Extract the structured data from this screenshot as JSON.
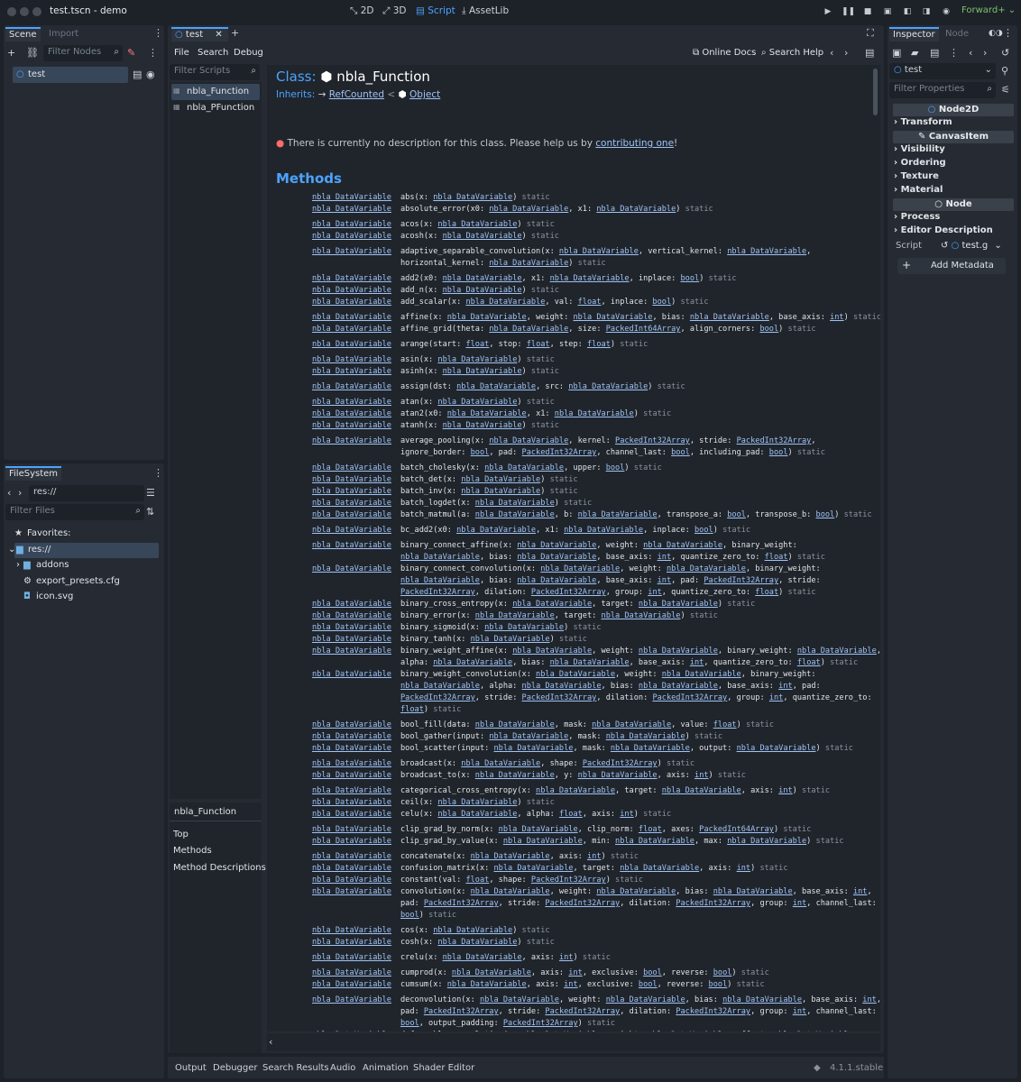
{
  "window": {
    "title": "test.tscn - demo",
    "renderer": "Forward+",
    "version": "4.1.1.stable"
  },
  "modes": [
    "2D",
    "3D",
    "Script",
    "AssetLib"
  ],
  "icons": {
    "mode_2d": "2d-viewport-icon",
    "mode_3d": "3d-viewport-icon",
    "mode_script": "script-icon",
    "mode_assetlib": "assetlib-icon",
    "play": "play-icon",
    "pause": "pause-icon",
    "stop": "stop-icon",
    "add": "plus-icon",
    "link": "link-icon",
    "search": "search-icon",
    "circle": "node-circle-icon",
    "eye": "eye-icon",
    "script": "script-icon",
    "folder": "folder-icon",
    "gear": "gear-icon",
    "image": "image-icon",
    "star": "star-icon",
    "filter": "filter-icon",
    "back": "back-icon",
    "doc": "doc-icon",
    "online": "external-link-icon"
  },
  "scene_dock": {
    "tabs": [
      "Scene",
      "Import"
    ],
    "filter_placeholder": "Filter Nodes",
    "root_node": "test"
  },
  "filesystem": {
    "title": "FileSystem",
    "path": "res://",
    "filter_placeholder": "Filter Files",
    "favorites_label": "Favorites:",
    "tree": [
      "res://",
      "addons",
      "export_presets.cfg",
      "icon.svg"
    ]
  },
  "script_editor": {
    "tab": "test",
    "menu": [
      "File",
      "Search",
      "Debug"
    ],
    "online_docs": "Online Docs",
    "search_help": "Search Help",
    "filter_scripts_placeholder": "Filter Scripts",
    "scripts": [
      "nbla_Function",
      "nbla_PFunction"
    ],
    "outline_title": "nbla_Function",
    "outline": [
      "Top",
      "Methods",
      "Method Descriptions"
    ]
  },
  "doc": {
    "class_label": "Class:",
    "class_name": "nbla_Function",
    "inherits_label": "Inherits:",
    "inherits": [
      "RefCounted",
      "Object"
    ],
    "no_desc": "There is currently no description for this class. Please help us by ",
    "contrib": "contributing one",
    "methods_title": "Methods",
    "ret_type": "nbla_DataVariable"
  },
  "methods": [
    [
      0,
      "abs(x: ~nbla_DataVariable~) static"
    ],
    [
      13,
      "absolute_error(x0: ~nbla_DataVariable~, x1: ~nbla_DataVariable~) static"
    ],
    [
      30,
      "acos(x: ~nbla_DataVariable~) static"
    ],
    [
      43,
      "acosh(x: ~nbla_DataVariable~) static"
    ],
    [
      60,
      "adaptive_separable_convolution(x: ~nbla_DataVariable~, vertical_kernel: ~nbla_DataVariable~,"
    ],
    [
      73,
      "~horizontal_kernel: ~nbla_DataVariable~) static"
    ],
    [
      90,
      "add2(x0: ~nbla_DataVariable~, x1: ~nbla_DataVariable~, inplace: ~bool~) static"
    ],
    [
      103,
      "add_n(x: ~nbla_DataVariable~) static"
    ],
    [
      116,
      "add_scalar(x: ~nbla_DataVariable~, val: ~float~, inplace: ~bool~) static"
    ],
    [
      133,
      "affine(x: ~nbla_DataVariable~, weight: ~nbla_DataVariable~, bias: ~nbla_DataVariable~, base_axis: ~int~) static"
    ],
    [
      146,
      "affine_grid(theta: ~nbla_DataVariable~, size: ~PackedInt64Array~, align_corners: ~bool~) static"
    ],
    [
      163,
      "arange(start: ~float~, stop: ~float~, step: ~float~) static"
    ],
    [
      180,
      "asin(x: ~nbla_DataVariable~) static"
    ],
    [
      193,
      "asinh(x: ~nbla_DataVariable~) static"
    ],
    [
      210,
      "assign(dst: ~nbla_DataVariable~, src: ~nbla_DataVariable~) static"
    ],
    [
      227,
      "atan(x: ~nbla_DataVariable~) static"
    ],
    [
      240,
      "atan2(x0: ~nbla_DataVariable~, x1: ~nbla_DataVariable~) static"
    ],
    [
      253,
      "atanh(x: ~nbla_DataVariable~) static"
    ],
    [
      270,
      "average_pooling(x: ~nbla_DataVariable~, kernel: ~PackedInt32Array~, stride: ~PackedInt32Array~,"
    ],
    [
      283,
      "~ignore_border: ~bool~, pad: ~PackedInt32Array~, channel_last: ~bool~, including_pad: ~bool~) static"
    ],
    [
      300,
      "batch_cholesky(x: ~nbla_DataVariable~, upper: ~bool~) static"
    ],
    [
      313,
      "batch_det(x: ~nbla_DataVariable~) static"
    ],
    [
      326,
      "batch_inv(x: ~nbla_DataVariable~) static"
    ],
    [
      339,
      "batch_logdet(x: ~nbla_DataVariable~) static"
    ],
    [
      352,
      "batch_matmul(a: ~nbla_DataVariable~, b: ~nbla_DataVariable~, transpose_a: ~bool~, transpose_b: ~bool~) static"
    ],
    [
      369,
      "bc_add2(x0: ~nbla_DataVariable~, x1: ~nbla_DataVariable~, inplace: ~bool~) static"
    ],
    [
      386,
      "binary_connect_affine(x: ~nbla_DataVariable~, weight: ~nbla_DataVariable~, binary_weight:"
    ],
    [
      399,
      "~~nbla_DataVariable~, bias: ~nbla_DataVariable~, base_axis: ~int~, quantize_zero_to: ~float~) static"
    ],
    [
      412,
      "binary_connect_convolution(x: ~nbla_DataVariable~, weight: ~nbla_DataVariable~, binary_weight:"
    ],
    [
      425,
      "~~nbla_DataVariable~, bias: ~nbla_DataVariable~, base_axis: ~int~, pad: ~PackedInt32Array~, stride:"
    ],
    [
      438,
      "~~PackedInt32Array~, dilation: ~PackedInt32Array~, group: ~int~, quantize_zero_to: ~float~) static"
    ],
    [
      451,
      "binary_cross_entropy(x: ~nbla_DataVariable~, target: ~nbla_DataVariable~) static"
    ],
    [
      464,
      "binary_error(x: ~nbla_DataVariable~, target: ~nbla_DataVariable~) static"
    ],
    [
      477,
      "binary_sigmoid(x: ~nbla_DataVariable~) static"
    ],
    [
      490,
      "binary_tanh(x: ~nbla_DataVariable~) static"
    ],
    [
      503,
      "binary_weight_affine(x: ~nbla_DataVariable~, weight: ~nbla_DataVariable~, binary_weight: ~nbla_DataVariable~,"
    ],
    [
      516,
      "~alpha: ~nbla_DataVariable~, bias: ~nbla_DataVariable~, base_axis: ~int~, quantize_zero_to: ~float~) static"
    ],
    [
      529,
      "binary_weight_convolution(x: ~nbla_DataVariable~, weight: ~nbla_DataVariable~, binary_weight:"
    ],
    [
      542,
      "~~nbla_DataVariable~, alpha: ~nbla_DataVariable~, bias: ~nbla_DataVariable~, base_axis: ~int~, pad:"
    ],
    [
      555,
      "~~PackedInt32Array~, stride: ~PackedInt32Array~, dilation: ~PackedInt32Array~, group: ~int~, quantize_zero_to:"
    ],
    [
      568,
      "~~float~) static"
    ],
    [
      585,
      "bool_fill(data: ~nbla_DataVariable~, mask: ~nbla_DataVariable~, value: ~float~) static"
    ],
    [
      598,
      "bool_gather(input: ~nbla_DataVariable~, mask: ~nbla_DataVariable~) static"
    ],
    [
      611,
      "bool_scatter(input: ~nbla_DataVariable~, mask: ~nbla_DataVariable~, output: ~nbla_DataVariable~) static"
    ],
    [
      628,
      "broadcast(x: ~nbla_DataVariable~, shape: ~PackedInt32Array~) static"
    ],
    [
      641,
      "broadcast_to(x: ~nbla_DataVariable~, y: ~nbla_DataVariable~, axis: ~int~) static"
    ],
    [
      658,
      "categorical_cross_entropy(x: ~nbla_DataVariable~, target: ~nbla_DataVariable~, axis: ~int~) static"
    ],
    [
      671,
      "ceil(x: ~nbla_DataVariable~) static"
    ],
    [
      684,
      "celu(x: ~nbla_DataVariable~, alpha: ~float~, axis: ~int~) static"
    ],
    [
      701,
      "clip_grad_by_norm(x: ~nbla_DataVariable~, clip_norm: ~float~, axes: ~PackedInt64Array~) static"
    ],
    [
      714,
      "clip_grad_by_value(x: ~nbla_DataVariable~, min: ~nbla_DataVariable~, max: ~nbla_DataVariable~) static"
    ],
    [
      731,
      "concatenate(x: ~nbla_DataVariable~, axis: ~int~) static"
    ],
    [
      744,
      "confusion_matrix(x: ~nbla_DataVariable~, target: ~nbla_DataVariable~, axis: ~int~) static"
    ],
    [
      757,
      "constant(val: ~float~, shape: ~PackedInt32Array~) static"
    ],
    [
      770,
      "convolution(x: ~nbla_DataVariable~, weight: ~nbla_DataVariable~, bias: ~nbla_DataVariable~, base_axis: ~int~,"
    ],
    [
      783,
      "~pad: ~PackedInt32Array~, stride: ~PackedInt32Array~, dilation: ~PackedInt32Array~, group: ~int~, channel_last:"
    ],
    [
      796,
      "~~bool~) static"
    ],
    [
      813,
      "cos(x: ~nbla_DataVariable~) static"
    ],
    [
      826,
      "cosh(x: ~nbla_DataVariable~) static"
    ],
    [
      843,
      "crelu(x: ~nbla_DataVariable~, axis: ~int~) static"
    ],
    [
      860,
      "cumprod(x: ~nbla_DataVariable~, axis: ~int~, exclusive: ~bool~, reverse: ~bool~) static"
    ],
    [
      873,
      "cumsum(x: ~nbla_DataVariable~, axis: ~int~, exclusive: ~bool~, reverse: ~bool~) static"
    ],
    [
      890,
      "deconvolution(x: ~nbla_DataVariable~, weight: ~nbla_DataVariable~, bias: ~nbla_DataVariable~, base_axis: ~int~,"
    ],
    [
      903,
      "~pad: ~PackedInt32Array~, stride: ~PackedInt32Array~, dilation: ~PackedInt32Array~, group: ~int~, channel_last:"
    ],
    [
      916,
      "~~bool~, output_padding: ~PackedInt32Array~) static"
    ],
    [
      929,
      "deformable_convolution(x: ~nbla_DataVariable~, weight: ~nbla_DataVariable~, offset: ~nbla_DataVariable~,"
    ]
  ],
  "bottom_tabs": [
    "Output",
    "Debugger",
    "Search Results",
    "Audio",
    "Animation",
    "Shader Editor"
  ],
  "inspector": {
    "tabs": [
      "Inspector",
      "Node"
    ],
    "object": "test",
    "filter_placeholder": "Filter Properties",
    "sections": [
      "Node2D",
      "CanvasItem",
      "Node"
    ],
    "node2d_cats": [
      "Transform"
    ],
    "canvas_cats": [
      "Visibility",
      "Ordering",
      "Texture",
      "Material"
    ],
    "node_cats": [
      "Process",
      "Editor Description"
    ],
    "script_label": "Script",
    "script_value": "test.g",
    "add_metadata": "Add Metadata"
  },
  "colors": {
    "accent": "#4da3ff",
    "link": "#9fc3f5",
    "renderer": "#7bc36a",
    "warning": "#ff6b6b"
  }
}
